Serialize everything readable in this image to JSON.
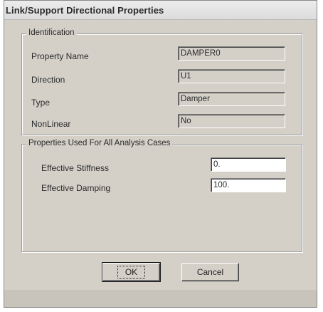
{
  "dialog": {
    "title": "Link/Support Directional Properties"
  },
  "identification": {
    "legend": "Identification",
    "rows": [
      {
        "label": "Property Name",
        "value": "DAMPER0"
      },
      {
        "label": "Direction",
        "value": "U1"
      },
      {
        "label": "Type",
        "value": "Damper"
      },
      {
        "label": "NonLinear",
        "value": "No"
      }
    ]
  },
  "properties": {
    "legend": "Properties Used For All Analysis Cases",
    "effective_stiffness": {
      "label": "Effective Stiffness",
      "value": "0."
    },
    "effective_damping": {
      "label": "Effective Damping",
      "value": "100."
    }
  },
  "buttons": {
    "ok_label": "OK",
    "cancel_label": "Cancel"
  },
  "colors": {
    "dialog_background": "#d4d0c8",
    "text": "#2b2b2b"
  }
}
